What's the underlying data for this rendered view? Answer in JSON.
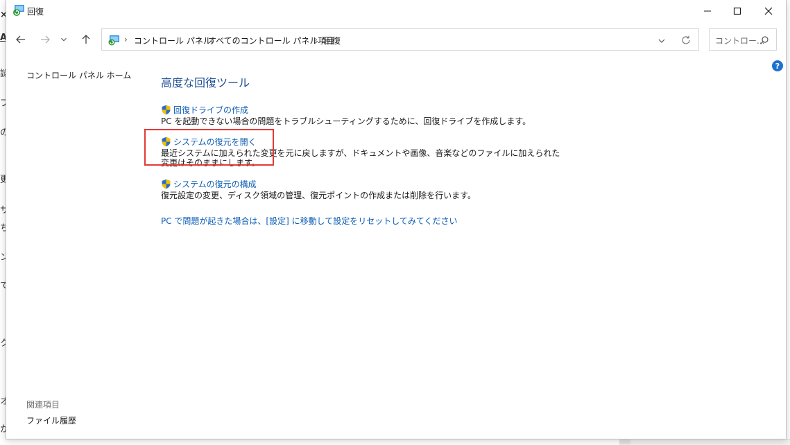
{
  "background": {
    "left_glyphs": [
      "×",
      "A",
      "謎",
      "フ",
      "の",
      "更",
      "サ",
      "ち",
      "ン",
      "て",
      "ク",
      "オ",
      "か"
    ]
  },
  "window": {
    "title": "回復",
    "controls": [
      "minimize-icon",
      "maximize-icon",
      "close-icon"
    ]
  },
  "nav": {
    "back_icon": "arrow-left-icon",
    "forward_icon": "arrow-right-icon",
    "up_icon": "arrow-up-icon"
  },
  "address": {
    "crumbs": [
      "コントロール パネル",
      "すべてのコントロール パネル項目",
      "回復"
    ],
    "separator": "›"
  },
  "search": {
    "placeholder": "コントロー..."
  },
  "sidebar": {
    "home": "コントロール パネル ホーム",
    "related_heading": "関連項目",
    "related_link": "ファイル履歴"
  },
  "help": {
    "label": "?"
  },
  "main": {
    "heading": "高度な回復ツール",
    "tools": [
      {
        "title": "回復ドライブの作成",
        "desc": "PC を起動できない場合の問題をトラブルシューティングするために、回復ドライブを作成します。"
      },
      {
        "title": "システムの復元を開く",
        "desc": "最近システムに加えられた変更を元に戻しますが、ドキュメントや画像、音楽などのファイルに加えられた変更はそのままにします。"
      },
      {
        "title": "システムの復元の構成",
        "desc": "復元設定の変更、ディスク領域の管理、復元ポイントの作成または削除を行います。"
      }
    ],
    "reset_link": "PC で問題が起きた場合は、[設定] に移動して設定をリセットしてみてください"
  },
  "colors": {
    "link": "#0a5cb5",
    "heading": "#1f4f96",
    "highlight": "#e53935"
  }
}
